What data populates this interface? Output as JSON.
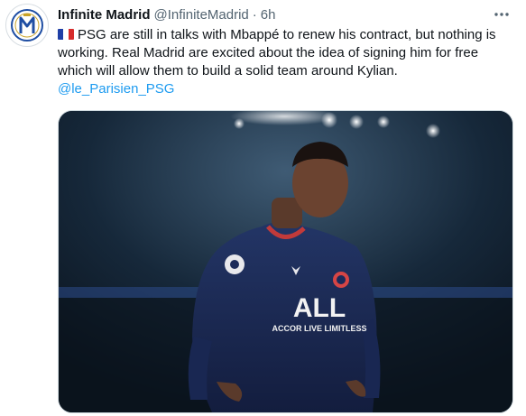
{
  "tweet": {
    "author_name": "Infinite Madrid",
    "author_handle": "@InfiniteMadrid",
    "separator": "·",
    "time": "6h",
    "more_icon": "ellipsis-icon",
    "avatar_icon": "real-madrid-crest-icon",
    "flag_icon": "france-flag-icon",
    "text_lines": [
      "PSG are still in talks with Mbappé to renew his contract, but nothing is",
      "working. Real Madrid are excited about the idea of signing him for free",
      "which will allow them to build a solid team around Kylian."
    ],
    "mention": "@le_Parisien",
    "mention_suffix": "_PSG",
    "media": {
      "shirt_sponsor": "ACCOR LIVE LIMITLESS",
      "shirt_logo": "ALL"
    }
  },
  "colors": {
    "link": "#1d9bf0",
    "secondary_text": "#536471",
    "avatar_blue": "#1f4ea3",
    "avatar_gold": "#c9a227",
    "shirt_navy": "#1b2a5a",
    "collar_red": "#c23a3a"
  }
}
